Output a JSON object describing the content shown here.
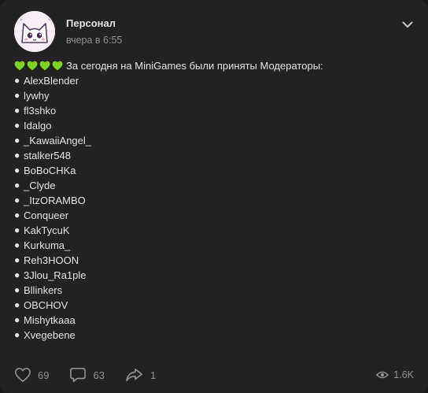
{
  "author": {
    "name": "Персонал",
    "time": "вчера в 6:55"
  },
  "post": {
    "hearts": [
      "green-heart",
      "green-heart",
      "green-heart",
      "green-heart"
    ],
    "heart_color": "#7ed321",
    "intro": "За сегодня на MiniGames были приняты Модераторы:",
    "bullet": "●",
    "moderators": [
      "AlexBlender",
      "lywhy",
      "fl3shko",
      "Idalgo",
      "_KawaiiAngel_",
      "stalker548",
      "BoBoCHKa",
      "_Clyde",
      "_ItzORAMBO",
      "Conqueer",
      "KakTycuK",
      "Kurkuma_",
      "Reh3HOON",
      "3Jlou_Ra1ple",
      "Bllinkers",
      "OBCHOV",
      "Mishytkaaa",
      "Xvegebene"
    ]
  },
  "footer": {
    "likes": "69",
    "comments": "63",
    "shares": "1",
    "views": "1.6K"
  },
  "colors": {
    "background": "#222222",
    "text": "#e1e3e6",
    "secondary": "#939393"
  }
}
